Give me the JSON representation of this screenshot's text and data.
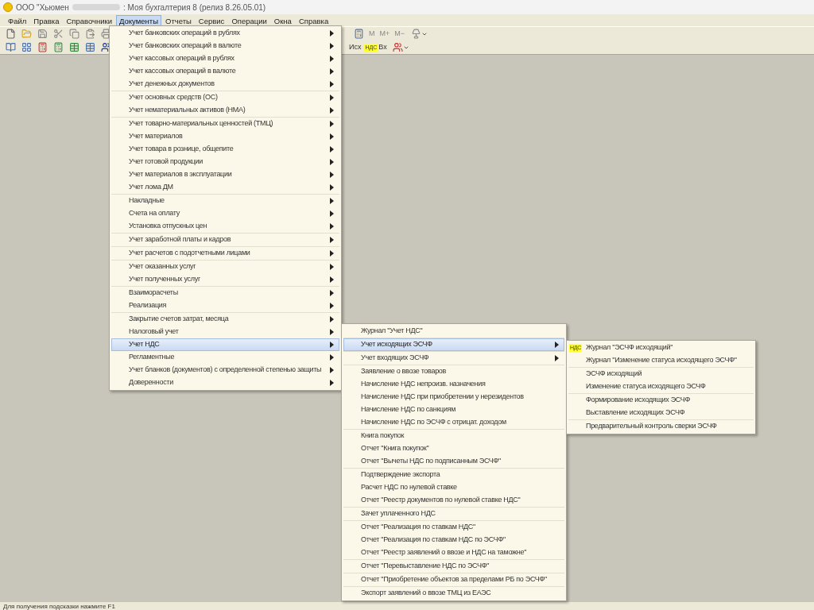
{
  "window": {
    "title_start": "ООО \"Хьюмен",
    "title_end": ": Моя бухгалтерия 8 (релиз 8.26.05.01)"
  },
  "menubar": [
    {
      "label": "Файл",
      "selected": false
    },
    {
      "label": "Правка",
      "selected": false
    },
    {
      "label": "Справочники",
      "selected": false
    },
    {
      "label": "Документы",
      "selected": true
    },
    {
      "label": "Отчеты",
      "selected": false
    },
    {
      "label": "Сервис",
      "selected": false
    },
    {
      "label": "Операции",
      "selected": false
    },
    {
      "label": "Окна",
      "selected": false
    },
    {
      "label": "Справка",
      "selected": false
    }
  ],
  "toolbar_1": {
    "right_labels": [
      "М",
      "М+",
      "М−"
    ]
  },
  "toolbar_2": {
    "outgoing": "Исх",
    "badge": "НДС",
    "incoming": "Вх"
  },
  "menus": [
    {
      "groups": [
        [
          {
            "label": "Учет банковских операций в рублях",
            "submenu": true,
            "selected": false
          },
          {
            "label": "Учет банковских операций в валюте",
            "submenu": true,
            "selected": false
          },
          {
            "label": "Учет кассовых операций в рублях",
            "submenu": true,
            "selected": false
          },
          {
            "label": "Учет кассовых операций в валюте",
            "submenu": true,
            "selected": false
          },
          {
            "label": "Учет денежных документов",
            "submenu": true,
            "selected": false
          }
        ],
        [
          {
            "label": "Учет основных средств (ОС)",
            "submenu": true,
            "selected": false
          },
          {
            "label": "Учет нематериальных активов (НМА)",
            "submenu": true,
            "selected": false
          }
        ],
        [
          {
            "label": "Учет товарно-материальных ценностей (ТМЦ)",
            "submenu": true,
            "selected": false
          },
          {
            "label": "Учет материалов",
            "submenu": true,
            "selected": false
          },
          {
            "label": "Учет товара в рознице, общепите",
            "submenu": true,
            "selected": false
          },
          {
            "label": "Учет готовой продукции",
            "submenu": true,
            "selected": false
          },
          {
            "label": "Учет материалов в эксплуатации",
            "submenu": true,
            "selected": false
          },
          {
            "label": "Учет лома ДМ",
            "submenu": true,
            "selected": false
          }
        ],
        [
          {
            "label": "Накладные",
            "submenu": true,
            "selected": false
          },
          {
            "label": "Счета на оплату",
            "submenu": true,
            "selected": false
          },
          {
            "label": "Установка отпускных цен",
            "submenu": true,
            "selected": false
          }
        ],
        [
          {
            "label": "Учет заработной платы и кадров",
            "submenu": true,
            "selected": false
          }
        ],
        [
          {
            "label": "Учет расчетов с подотчетными лицами",
            "submenu": true,
            "selected": false
          }
        ],
        [
          {
            "label": "Учет оказанных услуг",
            "submenu": true,
            "selected": false
          },
          {
            "label": "Учет полученных услуг",
            "submenu": true,
            "selected": false
          }
        ],
        [
          {
            "label": "Взаиморасчеты",
            "submenu": true,
            "selected": false
          },
          {
            "label": "Реализация",
            "submenu": true,
            "selected": false
          }
        ],
        [
          {
            "label": "Закрытие счетов затрат, месяца",
            "submenu": true,
            "selected": false
          },
          {
            "label": "Налоговый учет",
            "submenu": true,
            "selected": false
          },
          {
            "label": "Учет НДС",
            "submenu": true,
            "selected": true
          },
          {
            "label": "Регламентные",
            "submenu": true,
            "selected": false
          },
          {
            "label": "Учет бланков (документов) с определенной степенью защиты",
            "submenu": true,
            "selected": false
          },
          {
            "label": "Доверенности",
            "submenu": true,
            "selected": false
          }
        ]
      ]
    },
    {
      "groups": [
        [
          {
            "label": "Журнал \"Учет НДС\"",
            "submenu": false,
            "selected": false
          }
        ],
        [
          {
            "label": "Учет исходящих ЭСЧФ",
            "submenu": true,
            "selected": true
          }
        ],
        [
          {
            "label": "Учет входящих ЭСЧФ",
            "submenu": true,
            "selected": false
          }
        ],
        [
          {
            "label": "Заявление о ввозе товаров",
            "submenu": false,
            "selected": false
          },
          {
            "label": "Начисление НДС непроизв. назначения",
            "submenu": false,
            "selected": false
          },
          {
            "label": "Начисление НДС при приобретении у нерезидентов",
            "submenu": false,
            "selected": false
          },
          {
            "label": "Начисление НДС по санкциям",
            "submenu": false,
            "selected": false
          },
          {
            "label": "Начисление НДС по ЭСЧФ с отрицат. доходом",
            "submenu": false,
            "selected": false
          }
        ],
        [
          {
            "label": "Книга покупок",
            "submenu": false,
            "selected": false
          },
          {
            "label": "Отчет \"Книга покупок\"",
            "submenu": false,
            "selected": false
          },
          {
            "label": "Отчет \"Вычеты НДС по подписанным ЭСЧФ\"",
            "submenu": false,
            "selected": false
          }
        ],
        [
          {
            "label": "Подтверждение экспорта",
            "submenu": false,
            "selected": false
          },
          {
            "label": "Расчет НДС по нулевой ставке",
            "submenu": false,
            "selected": false
          },
          {
            "label": "Отчет \"Реестр документов по нулевой ставке НДС\"",
            "submenu": false,
            "selected": false
          }
        ],
        [
          {
            "label": "Зачет уплаченного НДС",
            "submenu": false,
            "selected": false
          }
        ],
        [
          {
            "label": "Отчет \"Реализация по ставкам НДС\"",
            "submenu": false,
            "selected": false
          },
          {
            "label": "Отчет \"Реализация по ставкам НДС по ЭСЧФ\"",
            "submenu": false,
            "selected": false
          },
          {
            "label": "Отчет \"Реестр заявлений о ввозе и НДС на таможне\"",
            "submenu": false,
            "selected": false
          }
        ],
        [
          {
            "label": "Отчет \"Перевыставление НДС по ЭСЧФ\"",
            "submenu": false,
            "selected": false
          }
        ],
        [
          {
            "label": "Отчет \"Приобретение объектов за пределами РБ по ЭСЧФ\"",
            "submenu": false,
            "selected": false
          }
        ],
        [
          {
            "label": "Экспорт заявлений о ввозе ТМЦ из ЕАЭС",
            "submenu": false,
            "selected": false
          }
        ]
      ]
    },
    {
      "groups": [
        [
          {
            "label": "Журнал \"ЭСЧФ исходящий\"",
            "submenu": false,
            "selected": false,
            "badge": "НДС"
          },
          {
            "label": "Журнал \"Изменение статуса исходящего ЭСЧФ\"",
            "submenu": false,
            "selected": false
          }
        ],
        [
          {
            "label": "ЭСЧФ исходящий",
            "submenu": false,
            "selected": false
          },
          {
            "label": "Изменение статуса исходящего ЭСЧФ",
            "submenu": false,
            "selected": false
          }
        ],
        [
          {
            "label": "Формирование исходящих ЭСЧФ",
            "submenu": false,
            "selected": false
          },
          {
            "label": "Выставление исходящих ЭСЧФ",
            "submenu": false,
            "selected": false
          }
        ],
        [
          {
            "label": "Предварительный контроль сверки ЭСЧФ",
            "submenu": false,
            "selected": false
          }
        ]
      ]
    }
  ],
  "status_bar": "Для получения подсказки нажмите F1"
}
